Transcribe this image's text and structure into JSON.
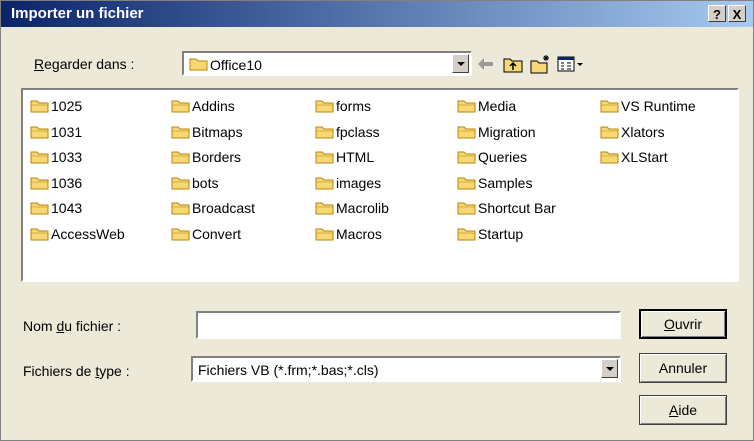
{
  "window": {
    "title": "Importer un fichier",
    "help_button": "?",
    "close_button": "X"
  },
  "look_in": {
    "label_u": "R",
    "label_rest": "egarder dans :",
    "value": "Office10"
  },
  "toolbar": {
    "icons": [
      "back-arrow-icon",
      "up-folder-icon",
      "new-folder-icon",
      "view-menu-icon"
    ]
  },
  "files": [
    [
      "1025",
      "1031",
      "1033",
      "1036",
      "1043",
      "AccessWeb"
    ],
    [
      "Addins",
      "Bitmaps",
      "Borders",
      "bots",
      "Broadcast",
      "Convert"
    ],
    [
      "forms",
      "fpclass",
      "HTML",
      "images",
      "Macrolib",
      "Macros"
    ],
    [
      "Media",
      "Migration",
      "Queries",
      "Samples",
      "Shortcut Bar",
      "Startup"
    ],
    [
      "VS Runtime",
      "Xlators",
      "XLStart"
    ]
  ],
  "filename": {
    "label_pre": "Nom ",
    "label_u": "d",
    "label_post": "u fichier :",
    "value": ""
  },
  "filetype": {
    "label_pre": "Fichiers de ",
    "label_u": "t",
    "label_post": "ype :",
    "value": "Fichiers VB (*.frm;*.bas;*.cls)"
  },
  "buttons": {
    "open_u": "O",
    "open_rest": "uvrir",
    "cancel": "Annuler",
    "help_u": "A",
    "help_rest": "ide"
  },
  "colors": {
    "title_start": "#0a246a",
    "title_end": "#a6caf0",
    "folder_fill": "#f8d775",
    "folder_stroke": "#b8860b"
  }
}
